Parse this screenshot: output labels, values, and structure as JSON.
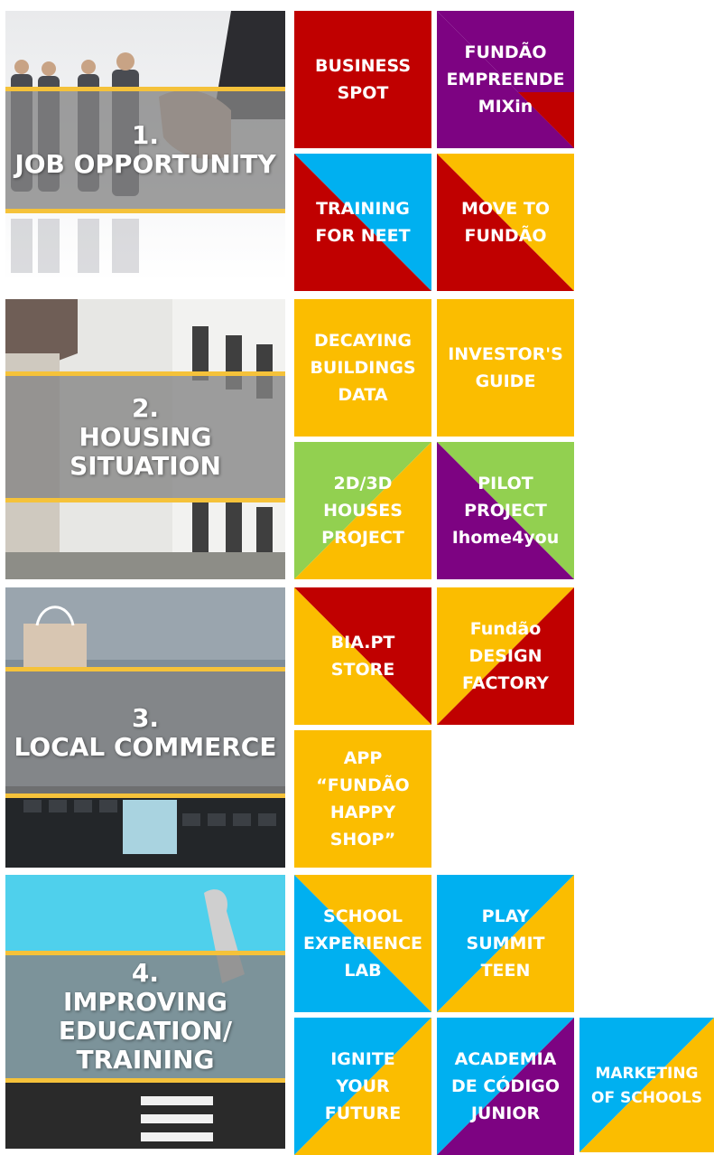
{
  "categories": [
    {
      "number": "1.",
      "lines": [
        "JOB OPPORTUNITY"
      ]
    },
    {
      "number": "2.",
      "lines": [
        "HOUSING",
        "SITUATION"
      ]
    },
    {
      "number": "3.",
      "lines": [
        "LOCAL COMMERCE"
      ]
    },
    {
      "number": "4.",
      "lines": [
        "IMPROVING",
        "EDUCATION/",
        "TRAINING"
      ]
    }
  ],
  "tiles": {
    "business_spot": {
      "label": "BUSINESS\nSPOT",
      "color": "#c00000"
    },
    "fundao_empreende": {
      "label": "FUNDÃO\nEMPREENDE\nMIXin",
      "colors": [
        "#7d0382",
        "#c00000"
      ]
    },
    "training_neet": {
      "label": "TRAINING\nFOR NEET",
      "colors": [
        "#00b0f0",
        "#c00000"
      ]
    },
    "move_to_fundao": {
      "label": "MOVE TO\nFUNDÃO",
      "colors": [
        "#fbbd00",
        "#c00000"
      ]
    },
    "decaying_buildings": {
      "label": "DECAYING\nBUILDINGS\nDATA",
      "color": "#fbbd00"
    },
    "investors_guide": {
      "label": "INVESTOR'S\nGUIDE",
      "color": "#fbbd00"
    },
    "houses_project": {
      "label": "2D/3D\nHOUSES\nPROJECT",
      "colors": [
        "#92d050",
        "#fbbd00"
      ]
    },
    "pilot_project": {
      "label": "PILOT\nPROJECT\nIhome4you",
      "colors": [
        "#92d050",
        "#7d0382"
      ]
    },
    "bia_store": {
      "label": "BIA.PT\nSTORE",
      "colors": [
        "#c00000",
        "#fbbd00"
      ]
    },
    "design_factory": {
      "label": "Fundão\nDESIGN\nFACTORY",
      "colors": [
        "#fbbd00",
        "#c00000"
      ]
    },
    "app_happy_shop": {
      "label": "APP\n“FUNDÃO\nHAPPY\nSHOP”",
      "color": "#fbbd00"
    },
    "school_experience": {
      "label": "SCHOOL\nEXPERIENCE\nLAB",
      "colors": [
        "#fbbd00",
        "#00b0f0"
      ]
    },
    "play_summit": {
      "label": "PLAY\nSUMMIT\nTEEN",
      "colors": [
        "#00b0f0",
        "#fbbd00"
      ]
    },
    "ignite_future": {
      "label": "IGNITE\nYOUR\nFUTURE",
      "colors": [
        "#00b0f0",
        "#fbbd00"
      ]
    },
    "academia_codigo": {
      "label": "ACADEMIA\nDE CÓDIGO\nJUNIOR",
      "colors": [
        "#00b0f0",
        "#7d0382"
      ]
    },
    "marketing_schools": {
      "label": "MARKETING\nOF SCHOOLS",
      "colors": [
        "#00b0f0",
        "#fbbd00"
      ]
    }
  },
  "accent_colors": {
    "red": "#c00000",
    "purple": "#7d0382",
    "yellow": "#fbbd00",
    "blue": "#00b0f0",
    "green": "#92d050",
    "band_border": "#f5c23a"
  }
}
